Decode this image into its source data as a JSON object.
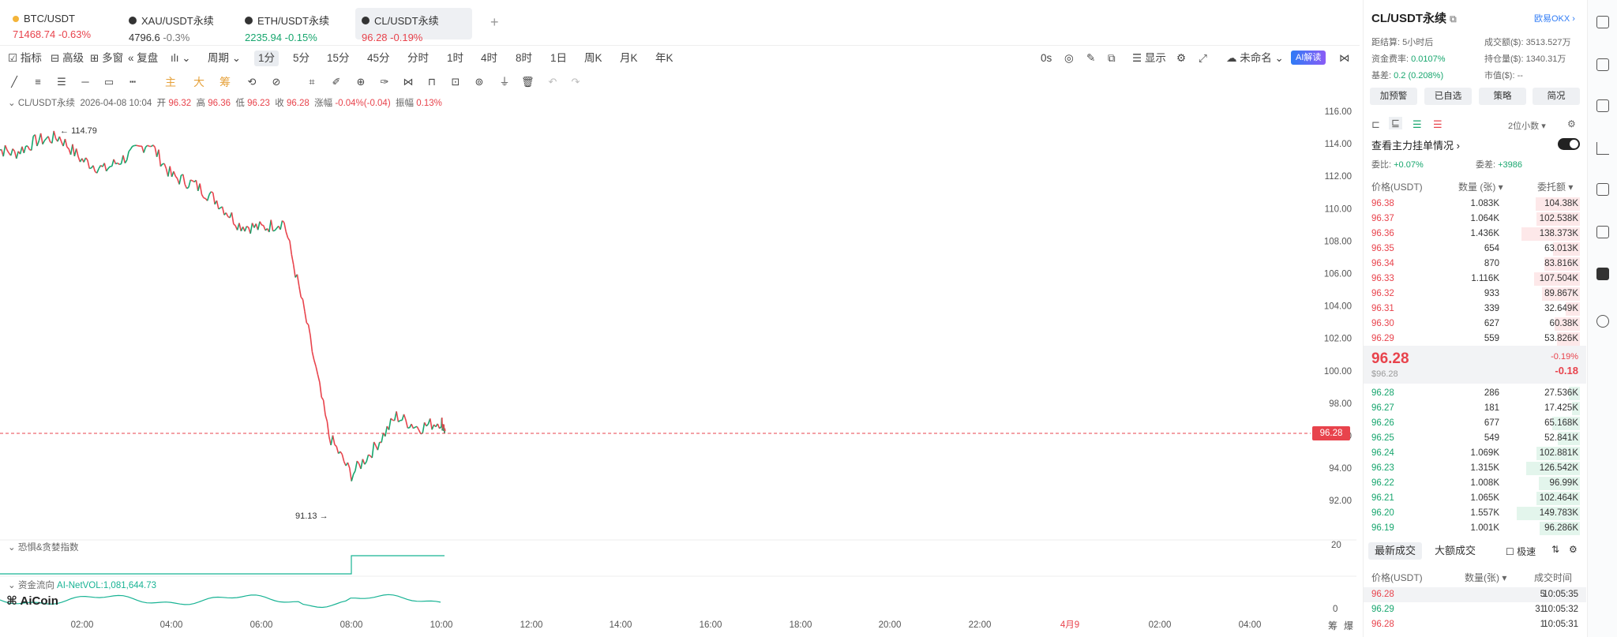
{
  "tabs": [
    {
      "name": "BTC/USDT",
      "price": "71468.74",
      "change": "-0.63%",
      "dir": "red",
      "icon": "btc-coin-icon"
    },
    {
      "name": "XAU/USDT永续",
      "price": "4796.6",
      "change": "-0.3%",
      "dir": "gray",
      "icon": "coin-icon"
    },
    {
      "name": "ETH/USDT永续",
      "price": "2235.94",
      "change": "-0.15%",
      "dir": "green",
      "icon": "coin-icon"
    },
    {
      "name": "CL/USDT永续",
      "price": "96.28",
      "change": "-0.19%",
      "dir": "red",
      "icon": "coin-icon",
      "active": true
    }
  ],
  "add_tab": "+",
  "toolbar": {
    "indicators": "指标",
    "advanced": "高级",
    "multi_window": "多窗",
    "replay": "复盘",
    "period": "周期",
    "intervals": [
      "1分",
      "5分",
      "15分",
      "45分",
      "分时",
      "1时",
      "4时",
      "8时",
      "1日",
      "周K",
      "月K",
      "年K"
    ],
    "selected_interval": "1分",
    "countdown": "0s",
    "display": "显示",
    "unnamed": "未命名",
    "ai": "AI解读"
  },
  "drawbar": {
    "main": "主",
    "big": "大",
    "chip": "筹"
  },
  "info": {
    "symbol": "CL/USDT永续",
    "datetime": "2026-04-08 10:04",
    "open_label": "开",
    "open": "96.32",
    "high_label": "高",
    "high": "96.36",
    "low_label": "低",
    "low": "96.23",
    "close_label": "收",
    "close": "96.28",
    "chg_label": "涨幅",
    "chg": "-0.04%(-0.04)",
    "amp_label": "振幅",
    "amp": "0.13%"
  },
  "chart_data": {
    "type": "line",
    "y_axis": {
      "ticks": [
        "116.00",
        "114.00",
        "112.00",
        "110.00",
        "108.00",
        "106.00",
        "104.00",
        "102.00",
        "100.00",
        "98.00",
        "96.00",
        "94.00",
        "92.00"
      ]
    },
    "x_axis": {
      "ticks": [
        "02:00",
        "04:00",
        "06:00",
        "08:00",
        "10:00",
        "12:00",
        "14:00",
        "16:00",
        "18:00",
        "20:00",
        "22:00",
        "4月9",
        "02:00",
        "04:00"
      ]
    },
    "x": [
      "00:00",
      "00:30",
      "01:00",
      "01:30",
      "02:00",
      "02:30",
      "03:00",
      "03:30",
      "04:00",
      "04:30",
      "05:00",
      "05:30",
      "06:00",
      "06:30",
      "07:00",
      "07:30",
      "08:00",
      "08:30",
      "09:00",
      "09:30",
      "10:00",
      "10:05"
    ],
    "series": [
      {
        "values": [
          113.8,
          113.4,
          114.2,
          114.4,
          113.0,
          112.4,
          113.2,
          114.1,
          112.0,
          111.5,
          110.5,
          109.0,
          108.8,
          109.2,
          103.0,
          96.0,
          93.6,
          95.2,
          97.2,
          96.5,
          96.9,
          96.28
        ]
      }
    ],
    "high_marker": "114.79",
    "low_marker": "91.13",
    "last_price": "96.28",
    "fear_greed": {
      "label": "恐惧&贪婪指数",
      "scale_top": "20",
      "scale_bottom": "0"
    },
    "fund_flow": {
      "label": "资金流向",
      "value_text": "AI-NetVOL:1,081,644.73"
    }
  },
  "watermark": "AiCoin",
  "corner_labels": [
    "筹",
    "爆"
  ],
  "panel": {
    "title": "CL/USDT永续",
    "exchange": "欧易OKX",
    "funding_label": "距结算:",
    "funding_time": "5小时后",
    "rate_label": "资金费率:",
    "rate": "0.0107%",
    "basis_label": "基差:",
    "basis": "0.2 (0.208%)",
    "volume_label": "成交额($):",
    "volume": "3513.527万",
    "oi_label": "持仓量($):",
    "oi": "1340.31万",
    "mcap_label": "市值($):",
    "mcap": "--",
    "buttons": [
      "加预警",
      "已自选",
      "策略",
      "简况"
    ],
    "decimals": "2位小数",
    "view_main": "查看主力挂单情况",
    "ratio_label": "委比:",
    "ratio": "+0.07%",
    "diff_label": "委差:",
    "diff": "+3986",
    "headers": {
      "price": "价格(USDT)",
      "qty": "数量 (张)",
      "amount": "委托额"
    },
    "asks": [
      {
        "p": "96.38",
        "q": "1.083K",
        "a": "104.38K",
        "w": 0.7
      },
      {
        "p": "96.37",
        "q": "1.064K",
        "a": "102.538K",
        "w": 0.69
      },
      {
        "p": "96.36",
        "q": "1.436K",
        "a": "138.373K",
        "w": 0.93
      },
      {
        "p": "96.35",
        "q": "654",
        "a": "63.013K",
        "w": 0.42
      },
      {
        "p": "96.34",
        "q": "870",
        "a": "83.816K",
        "w": 0.56
      },
      {
        "p": "96.33",
        "q": "1.116K",
        "a": "107.504K",
        "w": 0.72
      },
      {
        "p": "96.32",
        "q": "933",
        "a": "89.867K",
        "w": 0.6
      },
      {
        "p": "96.31",
        "q": "339",
        "a": "32.649K",
        "w": 0.22
      },
      {
        "p": "96.30",
        "q": "627",
        "a": "60.38K",
        "w": 0.4
      },
      {
        "p": "96.29",
        "q": "559",
        "a": "53.826K",
        "w": 0.36
      }
    ],
    "mid": {
      "price": "96.28",
      "usd": "$96.28",
      "pct": "-0.19%",
      "abs": "-0.18"
    },
    "bids": [
      {
        "p": "96.28",
        "q": "286",
        "a": "27.536K",
        "w": 0.18
      },
      {
        "p": "96.27",
        "q": "181",
        "a": "17.425K",
        "w": 0.12
      },
      {
        "p": "96.26",
        "q": "677",
        "a": "65.168K",
        "w": 0.44
      },
      {
        "p": "96.25",
        "q": "549",
        "a": "52.841K",
        "w": 0.35
      },
      {
        "p": "96.24",
        "q": "1.069K",
        "a": "102.881K",
        "w": 0.69
      },
      {
        "p": "96.23",
        "q": "1.315K",
        "a": "126.542K",
        "w": 0.85
      },
      {
        "p": "96.22",
        "q": "1.008K",
        "a": "96.99K",
        "w": 0.65
      },
      {
        "p": "96.21",
        "q": "1.065K",
        "a": "102.464K",
        "w": 0.69
      },
      {
        "p": "96.20",
        "q": "1.557K",
        "a": "149.783K",
        "w": 1.0
      },
      {
        "p": "96.19",
        "q": "1.001K",
        "a": "96.286K",
        "w": 0.64
      }
    ],
    "trades_tab": "最新成交",
    "large_tab": "大额成交",
    "fast_label": "极速",
    "trade_headers": {
      "price": "价格(USDT)",
      "qty": "数量(张)",
      "time": "成交时间"
    },
    "trades": [
      {
        "p": "96.28",
        "q": "5",
        "t": "10:05:35",
        "dir": "red"
      },
      {
        "p": "96.29",
        "q": "31",
        "t": "10:05:32",
        "dir": "green"
      },
      {
        "p": "96.28",
        "q": "1",
        "t": "10:05:31",
        "dir": "red"
      }
    ]
  }
}
